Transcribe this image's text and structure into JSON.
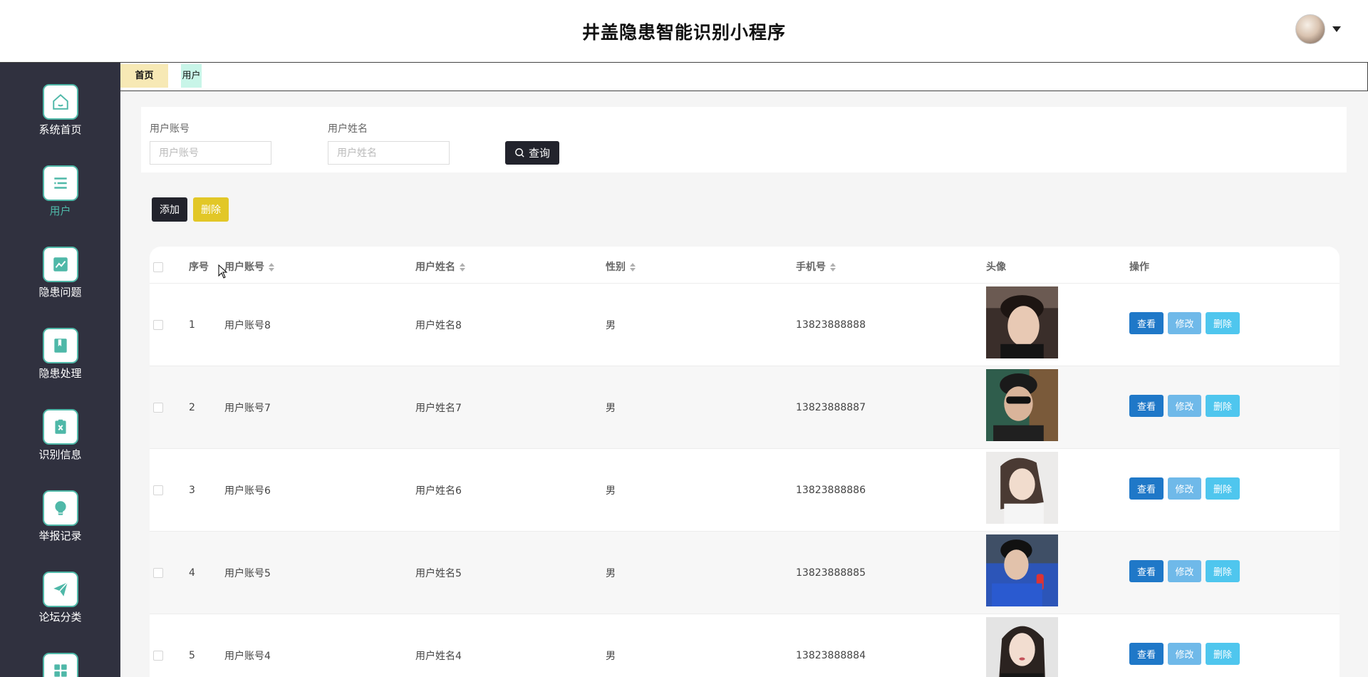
{
  "app": {
    "title": "井盖隐患智能识别小程序"
  },
  "sidebar": {
    "items": [
      {
        "label": "系统首页",
        "icon": "home-icon"
      },
      {
        "label": "用户",
        "icon": "list-icon"
      },
      {
        "label": "隐患问题",
        "icon": "chart-icon"
      },
      {
        "label": "隐患处理",
        "icon": "book-icon"
      },
      {
        "label": "识别信息",
        "icon": "clipboard-icon"
      },
      {
        "label": "举报记录",
        "icon": "bulb-icon"
      },
      {
        "label": "论坛分类",
        "icon": "send-icon"
      }
    ],
    "active_index": 1
  },
  "tabs": {
    "home": "首页",
    "user": "用户"
  },
  "search": {
    "account_label": "用户账号",
    "account_placeholder": "用户账号",
    "name_label": "用户姓名",
    "name_placeholder": "用户姓名",
    "button": "查询"
  },
  "actions": {
    "add": "添加",
    "delete": "删除"
  },
  "table": {
    "columns": {
      "index": "序号",
      "account": "用户账号",
      "name": "用户姓名",
      "gender": "性别",
      "phone": "手机号",
      "avatar": "头像",
      "ops": "操作"
    },
    "op_labels": {
      "view": "查看",
      "edit": "修改",
      "delete": "删除"
    },
    "rows": [
      {
        "index": "1",
        "account": "用户账号8",
        "name": "用户姓名8",
        "gender": "男",
        "phone": "13823888888"
      },
      {
        "index": "2",
        "account": "用户账号7",
        "name": "用户姓名7",
        "gender": "男",
        "phone": "13823888887"
      },
      {
        "index": "3",
        "account": "用户账号6",
        "name": "用户姓名6",
        "gender": "男",
        "phone": "13823888886"
      },
      {
        "index": "4",
        "account": "用户账号5",
        "name": "用户姓名5",
        "gender": "男",
        "phone": "13823888885"
      },
      {
        "index": "5",
        "account": "用户账号4",
        "name": "用户姓名4",
        "gender": "男",
        "phone": "13823888884"
      }
    ]
  },
  "colors": {
    "sidebar_bg": "#30313f",
    "accent": "#4fb8a8",
    "dark_button": "#22232c",
    "yellow_button": "#e2c727",
    "view_button": "#1f78c8"
  }
}
